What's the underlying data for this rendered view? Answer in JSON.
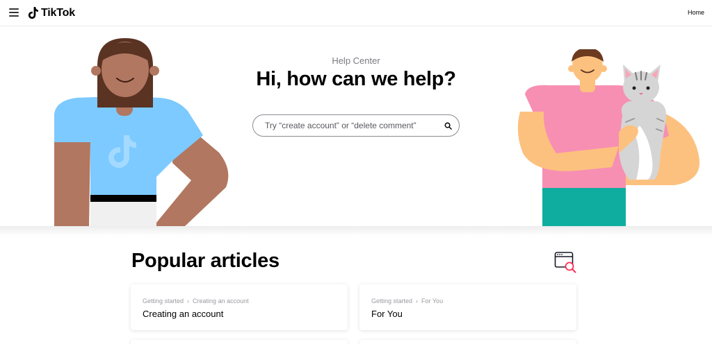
{
  "header": {
    "brand": "TikTok",
    "nav_home": "Home"
  },
  "hero": {
    "eyebrow": "Help Center",
    "title": "Hi, how can we help?",
    "search_placeholder": "Try “create account” or “delete comment”"
  },
  "popular": {
    "title": "Popular articles",
    "articles": [
      {
        "crumb_1": "Getting started",
        "crumb_2": "Creating an account",
        "title": "Creating an account"
      },
      {
        "crumb_1": "Getting started",
        "crumb_2": "For You",
        "title": "For You"
      }
    ]
  },
  "icons": {
    "menu": "hamburger-menu-icon",
    "logo": "tiktok-logo-icon",
    "search": "search-icon",
    "articles": "browser-search-icon",
    "crumb_separator": "chevron-right-icon"
  },
  "colors": {
    "accent_pink": "#fe2c55",
    "shirt_blue": "#7ccaff",
    "shirt_pink": "#f78fb3",
    "pants_teal": "#0fada0",
    "skin_dark": "#b17761",
    "skin_light": "#fdc17f"
  }
}
